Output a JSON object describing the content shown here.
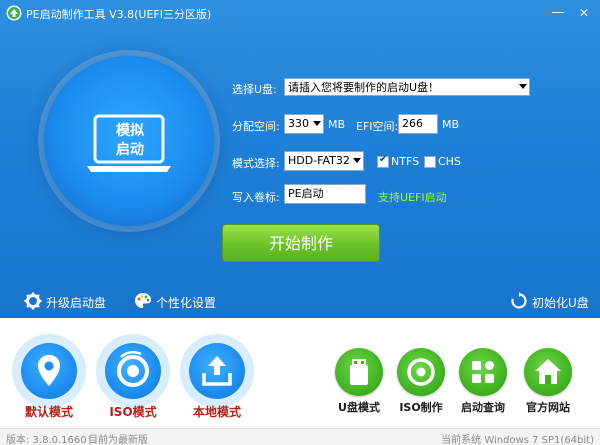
{
  "window": {
    "title": "PE启动制作工具 V3.8(UEFI三分区版)",
    "minimize_glyph": "—",
    "close_glyph": "✕"
  },
  "simulate": {
    "line1": "模拟",
    "line2": "启动"
  },
  "form": {
    "udisk_label": "选择U盘:",
    "udisk_value": "请插入您将要制作的启动U盘！",
    "partition_label": "分配空间:",
    "partition_value": "330",
    "partition_unit": "MB",
    "efi_label": "EFI空间:",
    "efi_value": "266",
    "efi_unit": "MB",
    "mode_label": "模式选择:",
    "mode_value": "HDD-FAT32",
    "ntfs_label": "NTFS",
    "ntfs_checked": true,
    "chs_label": "CHS",
    "chs_checked": false,
    "volume_label": "写入卷标:",
    "volume_value": "PE启动",
    "uefi_link": "支持UEFI启动"
  },
  "start_button": "开始制作",
  "toolbar": {
    "upgrade": "升级启动盘",
    "personalize": "个性化设置",
    "init": "初始化U盘"
  },
  "modes": [
    {
      "label": "默认模式",
      "icon": "location-pin-icon"
    },
    {
      "label": "ISO模式",
      "icon": "disc-icon"
    },
    {
      "label": "本地模式",
      "icon": "upload-icon"
    }
  ],
  "tools": [
    {
      "label": "U盘模式",
      "icon": "usb-drive-icon"
    },
    {
      "label": "ISO制作",
      "icon": "disc-icon"
    },
    {
      "label": "启动查询",
      "icon": "apps-grid-icon"
    },
    {
      "label": "官方网站",
      "icon": "home-icon"
    }
  ],
  "status": {
    "version": "版本: 3.8.0.1660",
    "latest": "目前为最新版",
    "system": "当前系统 Windows 7 SP1(64bit)"
  },
  "colors": {
    "top_bg": "#1e7fd6",
    "accent_green": "#6fc42a",
    "link_green": "#9cff3a",
    "mode_label_red": "#b8201b"
  }
}
